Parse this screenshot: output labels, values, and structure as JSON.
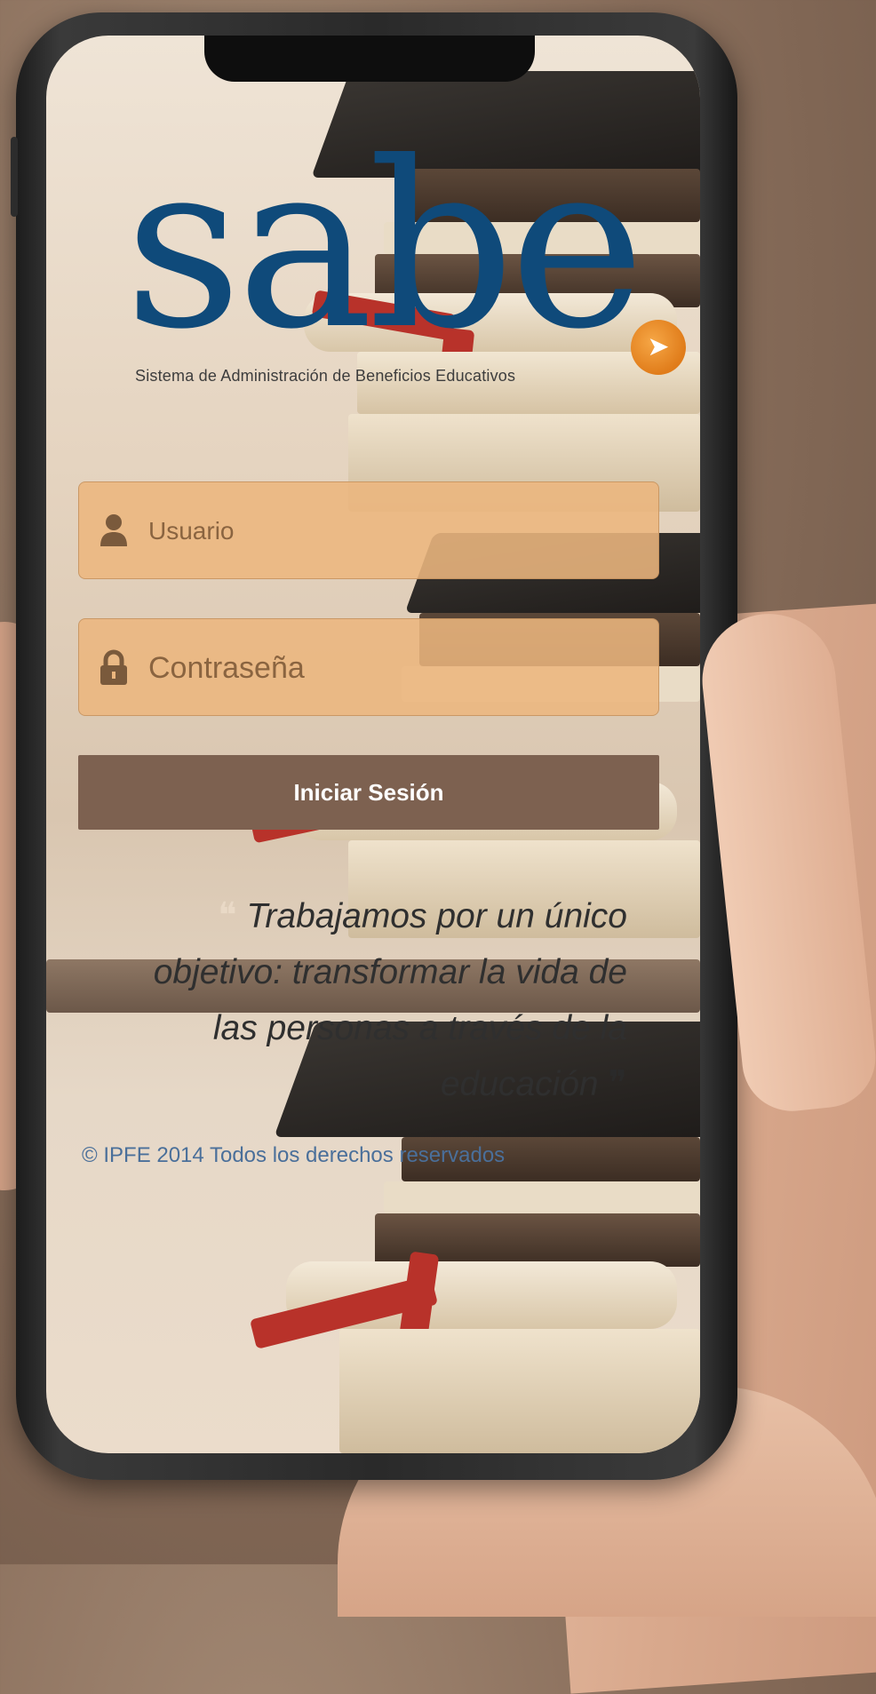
{
  "app": {
    "logo": "sabe",
    "tagline": "Sistema de Administración de Beneficios Educativos"
  },
  "login": {
    "username_placeholder": "Usuario",
    "password_placeholder": "Contraseña",
    "submit_label": "Iniciar Sesión"
  },
  "quote": {
    "open_mark": "❝",
    "text": "Trabajamos por un único objetivo: transformar la vida de las personas a través de la educación",
    "close_mark": "❞"
  },
  "footer": {
    "copyright": "© IPFE 2014 Todos los derechos reservados"
  },
  "colors": {
    "brand_blue": "#0f4a7a",
    "field_fill": "#ecb67e",
    "button_fill": "#7d6150",
    "footer_link": "#4a6f9a"
  },
  "icons": {
    "username": "user-icon",
    "password": "lock-icon",
    "logo_badge": "arrow-badge-icon"
  }
}
